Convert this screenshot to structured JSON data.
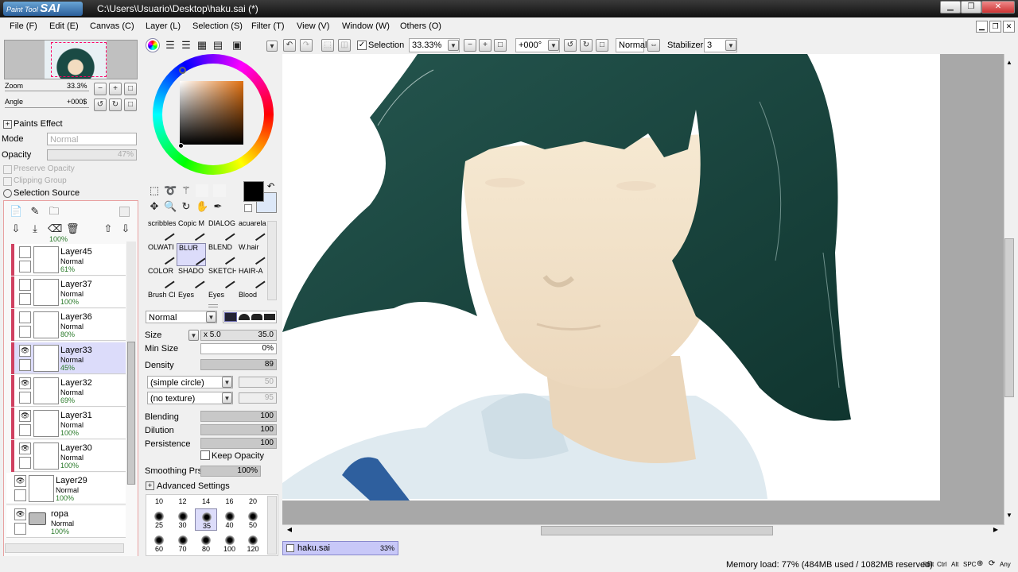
{
  "titlebar": {
    "app_name_small": "Paint Tool",
    "app_name_big": "SAI",
    "path": "C:\\Users\\Usuario\\Desktop\\haku.sai (*)"
  },
  "menu": [
    "File (F)",
    "Edit (E)",
    "Canvas (C)",
    "Layer (L)",
    "Selection (S)",
    "Filter (T)",
    "View (V)",
    "Window (W)",
    "Others (O)"
  ],
  "navigator": {
    "zoom_label": "Zoom",
    "zoom_value": "33.3%",
    "angle_label": "Angle",
    "angle_value": "+000$"
  },
  "paints_effect": {
    "title": "Paints Effect",
    "mode_label": "Mode",
    "mode_value": "Normal",
    "opacity_label": "Opacity",
    "opacity_value": "47%",
    "preserve_opacity": "Preserve Opacity",
    "clipping_group": "Clipping Group",
    "selection_source": "Selection Source"
  },
  "layers": [
    {
      "name": "Layer45",
      "mode": "Normal",
      "opacity": "61%",
      "visible": false,
      "selected": false,
      "bar": true
    },
    {
      "name": "Layer37",
      "mode": "Normal",
      "opacity": "100%",
      "visible": false,
      "selected": false,
      "bar": true
    },
    {
      "name": "Layer36",
      "mode": "Normal",
      "opacity": "80%",
      "visible": false,
      "selected": false,
      "bar": true
    },
    {
      "name": "Layer33",
      "mode": "Normal",
      "opacity": "45%",
      "visible": true,
      "selected": true,
      "bar": true
    },
    {
      "name": "Layer32",
      "mode": "Normal",
      "opacity": "69%",
      "visible": true,
      "selected": false,
      "bar": true
    },
    {
      "name": "Layer31",
      "mode": "Normal",
      "opacity": "100%",
      "visible": true,
      "selected": false,
      "bar": true
    },
    {
      "name": "Layer30",
      "mode": "Normal",
      "opacity": "100%",
      "visible": true,
      "selected": false,
      "bar": true
    },
    {
      "name": "Layer29",
      "mode": "Normal",
      "opacity": "100%",
      "visible": true,
      "selected": false,
      "bar": false
    },
    {
      "name": "ropa",
      "mode": "Normal",
      "opacity": "100%",
      "visible": true,
      "selected": false,
      "bar": false,
      "folder": true
    }
  ],
  "layers_partial_top": "100%",
  "canvas_toolbar": {
    "selection_label": "Selection",
    "zoom_value": "33.33%",
    "angle_value": "+000°",
    "blend_mode": "Normal",
    "stabilizer_label": "Stabilizer",
    "stabilizer_value": "3"
  },
  "brushes": [
    [
      "scribbles",
      "Copic M",
      "DIALOG",
      "acuarela"
    ],
    [
      "OLWATI",
      "BLUR",
      "BLEND",
      "W.hair"
    ],
    [
      "COLOR",
      "SHADO",
      "SKETCH",
      "HAIR-A"
    ],
    [
      "Brush Cl",
      "Eyes",
      "Eyes",
      "Blood"
    ]
  ],
  "brush_settings": {
    "mode": "Normal",
    "size_label": "Size",
    "size_mult": "x 5.0",
    "size_value": "35.0",
    "min_size_label": "Min Size",
    "min_size_value": "0%",
    "density_label": "Density",
    "density_value": "89",
    "shape": "(simple circle)",
    "shape_value": "50",
    "texture": "(no texture)",
    "texture_value": "95",
    "blending_label": "Blending",
    "blending_value": "100",
    "dilution_label": "Dilution",
    "dilution_value": "100",
    "persistence_label": "Persistence",
    "persistence_value": "100",
    "keep_opacity": "Keep Opacity",
    "smoothing_label": "Smoothing Prs",
    "smoothing_value": "100%",
    "advanced": "Advanced Settings"
  },
  "brush_sizes": [
    "10",
    "12",
    "14",
    "16",
    "20",
    "25",
    "30",
    "35",
    "40",
    "50",
    "60",
    "70",
    "80",
    "100",
    "120"
  ],
  "selected_brush_size": "35",
  "document_tab": {
    "name": "haku.sai",
    "zoom": "33%"
  },
  "status": {
    "memory": "Memory load: 77% (484MB used / 1082MB reserved)",
    "keys": [
      "Shft",
      "Ctrl",
      "Alt",
      "SPC",
      "Any"
    ]
  },
  "colors": {
    "primary": "#000000",
    "secondary": "#dde8f8",
    "hair": "#1c4a44",
    "skin": "#f3e3c6",
    "shirt": "#dde9ef",
    "strap": "#2e5f9e"
  }
}
